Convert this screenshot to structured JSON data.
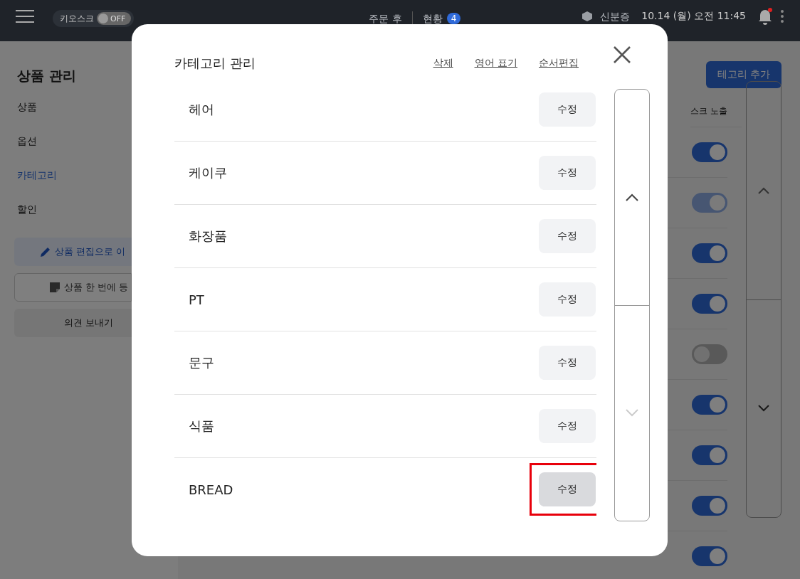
{
  "top_bar": {
    "kiosk_label": "키오스크",
    "kiosk_toggle": {
      "label": "OFF",
      "on": false
    },
    "order_after": "주문 후",
    "status": {
      "label": "현황",
      "count": "4"
    },
    "id_check": "신분증",
    "datetime": "10.14 (월) 오전 11:45",
    "notification_dot": true
  },
  "sidebar": {
    "title": "상품 관리",
    "items": [
      {
        "label": "상품",
        "selected": false
      },
      {
        "label": "옵션",
        "selected": false
      },
      {
        "label": "카테고리",
        "selected": true
      },
      {
        "label": "할인",
        "selected": false
      }
    ],
    "buttons": [
      {
        "kind": "edit",
        "label": "상품 편집으로 이"
      },
      {
        "kind": "upload",
        "label": "상품 한 번에 등"
      },
      {
        "kind": "feedback",
        "label": "의견 보내기"
      }
    ]
  },
  "main": {
    "add_button": "테고리 추가",
    "column_header": "스크 노출",
    "toggles": [
      {
        "on": true,
        "disabled": false
      },
      {
        "on": true,
        "disabled": true
      },
      {
        "on": true,
        "disabled": false
      },
      {
        "on": true,
        "disabled": false
      },
      {
        "on": false,
        "disabled": true
      },
      {
        "on": true,
        "disabled": false
      },
      {
        "on": true,
        "disabled": false
      },
      {
        "on": true,
        "disabled": false
      },
      {
        "on": true,
        "disabled": false
      }
    ]
  },
  "modal": {
    "title": "카테고리 관리",
    "links": [
      "삭제",
      "영어 표기",
      "순서편집"
    ],
    "rows": [
      {
        "name": "헤어",
        "button": "수정",
        "highlighted": false
      },
      {
        "name": "케이쿠",
        "button": "수정",
        "highlighted": false
      },
      {
        "name": "화장품",
        "button": "수정",
        "highlighted": false
      },
      {
        "name": "PT",
        "button": "수정",
        "highlighted": false
      },
      {
        "name": "문구",
        "button": "수정",
        "highlighted": false
      },
      {
        "name": "식품",
        "button": "수정",
        "highlighted": false
      },
      {
        "name": "BREAD",
        "button": "수정",
        "highlighted": true
      }
    ],
    "scroll": {
      "up_disabled": false,
      "down_disabled": true
    }
  }
}
